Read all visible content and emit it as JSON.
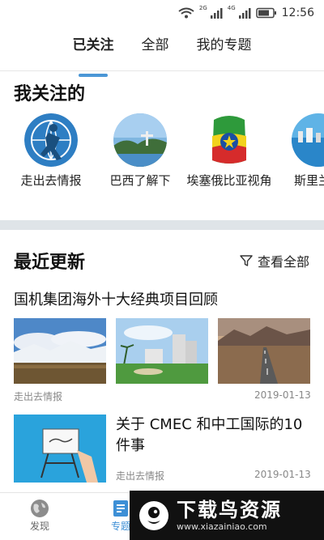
{
  "status_bar": {
    "time": "12:56",
    "net1": "2G",
    "net2": "4G",
    "wifi_icon": "wifi-icon",
    "battery_icon": "battery-icon"
  },
  "tabs": [
    {
      "label": "已关注",
      "active": true
    },
    {
      "label": "全部",
      "active": false
    },
    {
      "label": "我的专题",
      "active": false
    }
  ],
  "following": {
    "title": "我关注的",
    "items": [
      {
        "label": "走出去情报"
      },
      {
        "label": "巴西了解下"
      },
      {
        "label": "埃塞俄比亚视角"
      },
      {
        "label": "斯里兰卡"
      }
    ]
  },
  "recent": {
    "title": "最近更新",
    "view_all": "查看全部",
    "filter_icon": "filter-icon",
    "articles": [
      {
        "title": "国机集团海外十大经典项目回顾",
        "source": "走出去情报",
        "date": "2019-01-13"
      },
      {
        "title": "关于 CMEC 和中工国际的10件事",
        "source": "走出去情报",
        "date": "2019-01-13"
      }
    ]
  },
  "bottom_nav": [
    {
      "label": "发现",
      "icon": "globe-icon"
    },
    {
      "label": "专题",
      "icon": "topic-icon",
      "active": true
    }
  ],
  "watermark": {
    "brand": "下载鸟资源",
    "url": "www.xiazainiao.com"
  },
  "colors": {
    "accent": "#4b97d6",
    "divider": "#dfe4e8"
  }
}
